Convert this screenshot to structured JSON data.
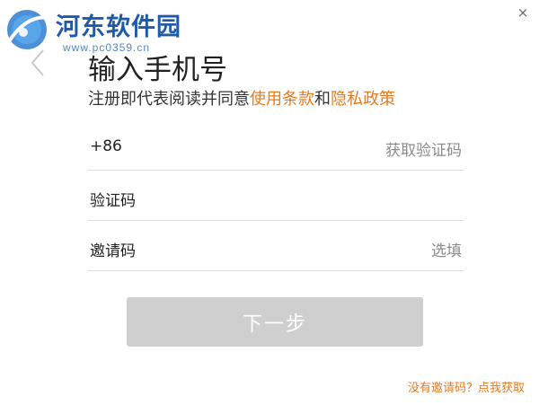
{
  "window": {
    "close_glyph": "×",
    "back_icon": "chevron-left-icon"
  },
  "watermark": {
    "title": "河东软件园",
    "url": "www.pc0359.cn",
    "logo_color": "#1f5aa8"
  },
  "header": {
    "title": "输入手机号",
    "terms_prefix": "注册即代表阅读并同意",
    "terms_link": "使用条款",
    "terms_and": "和",
    "privacy_link": "隐私政策"
  },
  "form": {
    "phone": {
      "country_code": "+86",
      "value": "",
      "action": "获取验证码"
    },
    "code": {
      "label": "验证码",
      "value": ""
    },
    "invite": {
      "label": "邀请码",
      "value": "",
      "hint": "选填"
    }
  },
  "next_button": {
    "label": "下一步",
    "state": "disabled"
  },
  "footer": {
    "invite_link": "没有邀请码？点我获取"
  },
  "colors": {
    "accent": "#e87a1e",
    "button_disabled": "#cfcfcf",
    "divider": "#dcdcdc"
  }
}
